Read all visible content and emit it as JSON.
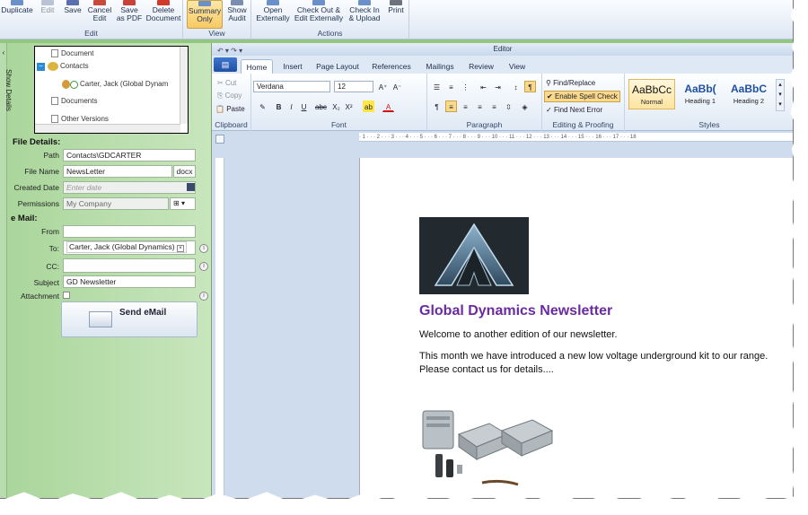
{
  "top_ribbon": {
    "edit_group": {
      "label": "Edit",
      "buttons": [
        {
          "label": "Duplicate"
        },
        {
          "label": "Edit"
        },
        {
          "label": "Save"
        },
        {
          "label": "Cancel\nEdit"
        },
        {
          "label": "Save\nas PDF"
        },
        {
          "label": "Delete\nDocument"
        }
      ]
    },
    "view_group": {
      "label": "View",
      "buttons": [
        {
          "label": "Summary\nOnly",
          "active": true
        },
        {
          "label": "Show\nAudit"
        }
      ]
    },
    "actions_group": {
      "label": "Actions",
      "buttons": [
        {
          "label": "Open\nExternally"
        },
        {
          "label": "Check Out &\nEdit Externally"
        },
        {
          "label": "Check In\n& Upload"
        },
        {
          "label": "Print"
        }
      ]
    }
  },
  "left_panel": {
    "vertical_tab": "Show Details",
    "tree": {
      "items": [
        {
          "label": "Document"
        },
        {
          "label": "Contacts"
        },
        {
          "label": "Carter, Jack (Global Dynam"
        },
        {
          "label": "Documents"
        },
        {
          "label": "Other Versions"
        }
      ]
    },
    "file_details": {
      "heading": "File Details:",
      "path_label": "Path",
      "path_value": "Contacts\\GDCARTER",
      "name_label": "File Name",
      "name_value": "NewsLetter",
      "ext": "docx",
      "created_label": "Created Date",
      "created_placeholder": "Enter date",
      "permissions_label": "Permissions",
      "permissions_value": "My Company"
    },
    "email": {
      "heading": "e Mail:",
      "from_label": "From",
      "to_label": "To:",
      "to_chip": "Carter, Jack (Global Dynamics)",
      "cc_label": "CC:",
      "subject_label": "Subject",
      "subject_value": "GD Newsletter",
      "attachment_label": "Attachment",
      "send_label": "Send eMail"
    }
  },
  "editor": {
    "window_title": "Editor",
    "tabs": [
      {
        "label": "Home",
        "active": true
      },
      {
        "label": "Insert"
      },
      {
        "label": "Page Layout"
      },
      {
        "label": "References"
      },
      {
        "label": "Mailings"
      },
      {
        "label": "Review"
      },
      {
        "label": "View"
      }
    ],
    "clipboard": {
      "label": "Clipboard",
      "cut": "Cut",
      "copy": "Copy",
      "paste": "Paste"
    },
    "font": {
      "label": "Font",
      "family": "Verdana",
      "size": "12"
    },
    "paragraph": {
      "label": "Paragraph"
    },
    "editing": {
      "label": "Editing & Proofing",
      "find_replace": "Find/Replace",
      "spell_check": "Enable Spell Check",
      "find_next_error": "Find Next Error"
    },
    "styles": {
      "label": "Styles",
      "items": [
        {
          "preview": "AaBbCc",
          "name": "Normal"
        },
        {
          "preview": "AaBb(",
          "name": "Heading 1"
        },
        {
          "preview": "AaBbC",
          "name": "Heading 2"
        }
      ]
    },
    "document": {
      "title": "Global Dynamics Newsletter",
      "paragraphs": [
        "Welcome to another edition of our newsletter.",
        "This month we have introduced a new low voltage underground kit to our range. Please contact us for details...."
      ]
    }
  },
  "colors": {
    "accent_purple": "#6a2aa0",
    "panel_green": "#a9d59a",
    "ribbon_blue": "#dfe9f6"
  }
}
